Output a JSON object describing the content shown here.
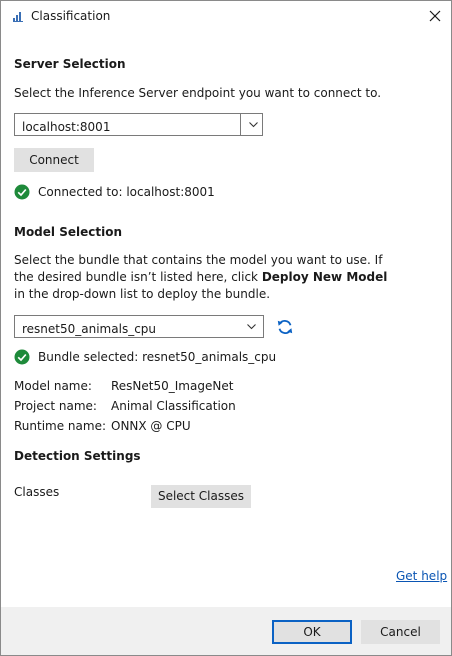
{
  "window": {
    "title": "Classification",
    "close_icon": "close-icon",
    "app_icon": "app-icon"
  },
  "server": {
    "heading": "Server Selection",
    "description": "Select the Inference Server endpoint you want to connect to.",
    "endpoint_value": "localhost:8001",
    "connect_label": "Connect",
    "status_text": "Connected to: localhost:8001",
    "status_color": "#1e8a3a"
  },
  "model": {
    "heading": "Model Selection",
    "description_part1": "Select the bundle that contains the model you want to use. If the desired bundle isn’t listed here, click ",
    "description_bold": "Deploy New Model",
    "description_part2": " in the drop-down list to deploy the bundle.",
    "bundle_value": "resnet50_animals_cpu",
    "refresh_icon": "refresh-icon",
    "status_text": "Bundle selected: resnet50_animals_cpu",
    "details": [
      {
        "label": "Model name:",
        "value": "ResNet50_ImageNet"
      },
      {
        "label": "Project name:",
        "value": "Animal Classification"
      },
      {
        "label": "Runtime name:",
        "value": "ONNX @ CPU"
      }
    ]
  },
  "detection": {
    "heading": "Detection Settings",
    "classes_label": "Classes",
    "select_classes_label": "Select Classes"
  },
  "help_link": "Get help",
  "footer": {
    "ok_label": "OK",
    "cancel_label": "Cancel"
  },
  "colors": {
    "accent": "#0b62c4",
    "link": "#0a55b3",
    "success": "#1e8a3a",
    "footer_bg": "#f0f0f0"
  }
}
